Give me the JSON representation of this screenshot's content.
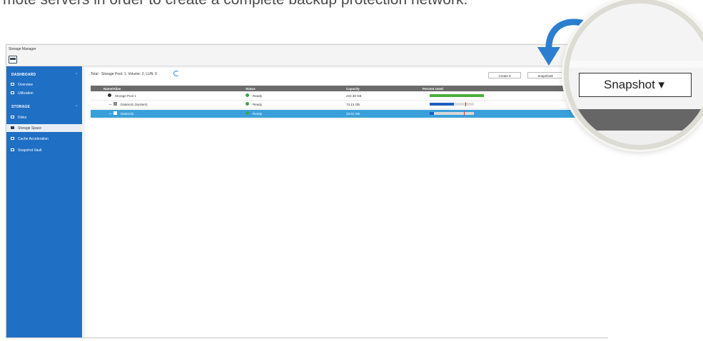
{
  "caption": "mote servers in order to create a complete backup protection network.",
  "app": {
    "title": "Storage Manager",
    "icon": "storage-manager-icon"
  },
  "sidebar": {
    "sections": [
      {
        "label": "DASHBOARD",
        "items": [
          {
            "label": "Overview",
            "icon": "overview-icon"
          },
          {
            "label": "Utilization",
            "icon": "utilization-icon"
          }
        ]
      },
      {
        "label": "STORAGE",
        "items": [
          {
            "label": "Disks",
            "icon": "disk-icon"
          },
          {
            "label": "Storage Space",
            "icon": "storage-space-icon",
            "active": true
          },
          {
            "label": "Cache Acceleration",
            "icon": "cache-icon"
          },
          {
            "label": "Snapshot Vault",
            "icon": "vault-icon"
          }
        ]
      }
    ]
  },
  "main": {
    "summary": "Total - Storage Pool: 1, Volume: 2, LUN: 0",
    "buttons": {
      "create": "Create ▾",
      "snapshot": "Snapshot▾"
    },
    "columns": [
      "Name/Alias",
      "Status",
      "Capacity",
      "Percent Used"
    ],
    "rows": [
      {
        "name": "Storage Pool 1",
        "status": "Ready",
        "capacity": "223.39 GB",
        "percent_used": 1.0
      },
      {
        "name": "DataVol1 (System)",
        "status": "Ready",
        "capacity": "73.13 GB",
        "percent_used": 0.55
      },
      {
        "name": "DataVol2",
        "status": "Ready",
        "capacity": "33.81 GB",
        "percent_used": 0.08
      }
    ]
  },
  "zoom": {
    "button_label": "Snapshot ▾"
  },
  "colors": {
    "sidebar": "#1f6fc4",
    "selected_row": "#3aa0db",
    "bar_green": "#4bae3c",
    "bar_blue": "#1f5fbf",
    "header": "#6b6b6b"
  }
}
